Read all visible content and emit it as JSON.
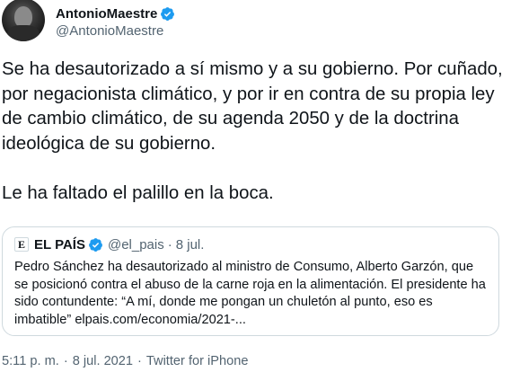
{
  "author": {
    "display_name": "AntonioMaestre",
    "handle": "@AntonioMaestre",
    "verified": true
  },
  "tweet": {
    "text": "Se ha desautorizado a sí mismo y a su gobierno. Por cuñado, por negacionista climático, y por ir en contra de su propia ley de cambio climático, de su agenda 2050 y de la doctrina ideológica de su gobierno.\n\nLe ha faltado el palillo en la boca."
  },
  "quoted_tweet": {
    "logo_letter": "E",
    "display_name": "EL PAÍS",
    "handle": "@el_pais",
    "separator": "·",
    "date": "8 jul.",
    "text": "Pedro Sánchez ha desautorizado al ministro de Consumo, Alberto Garzón, que se posicionó contra el abuso de la carne roja en la alimentación. El presidente ha sido contundente: “A mí, donde me pongan un chuletón al punto, eso es imbatible” elpais.com/economia/2021-..."
  },
  "footer": {
    "time": "5:11 p. m.",
    "sep1": "·",
    "date": "8 jul. 2021",
    "sep2": "·",
    "source": "Twitter for iPhone"
  },
  "colors": {
    "verified_blue": "#1d9bf0",
    "text_primary": "#0f1419",
    "text_secondary": "#536471",
    "border": "#cfd9de"
  },
  "icons": {
    "verified": "verified-badge-icon",
    "avatar": "user-avatar"
  }
}
